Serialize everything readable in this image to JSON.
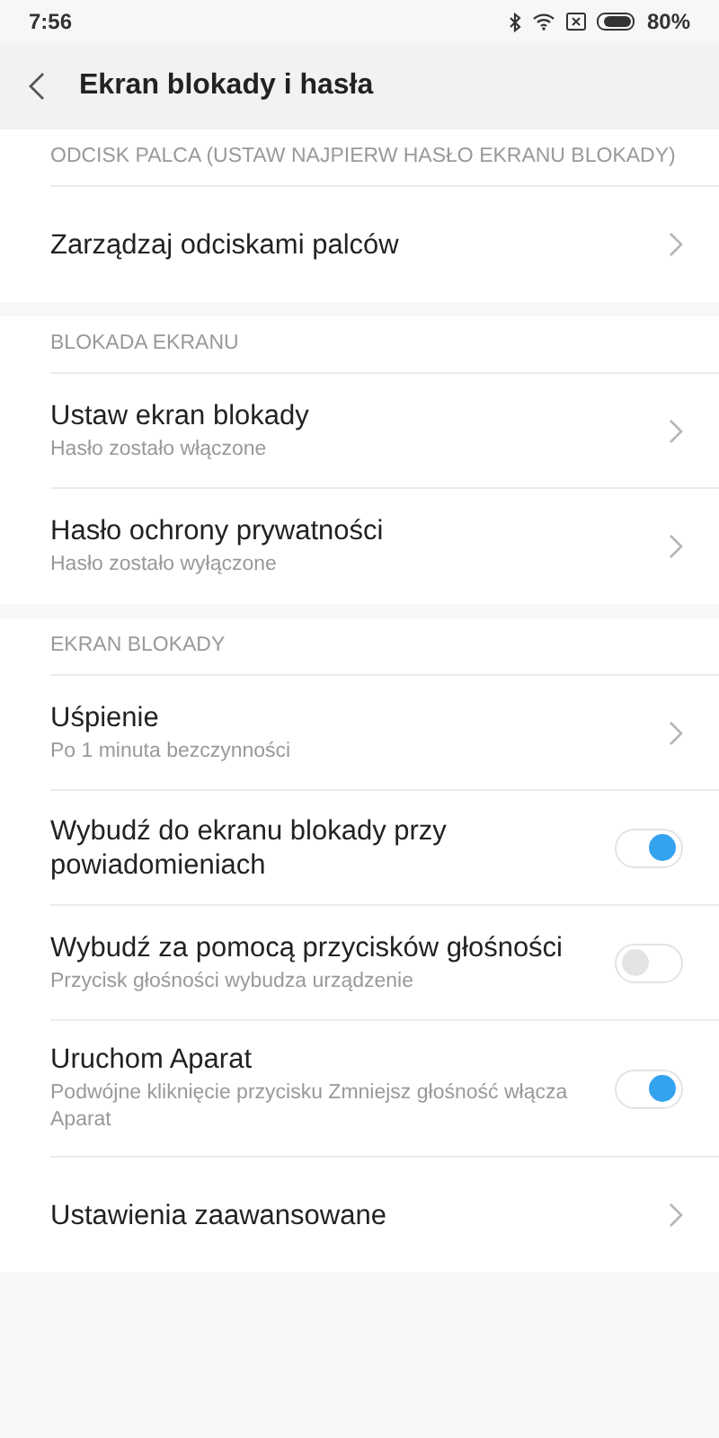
{
  "status_bar": {
    "time": "7:56",
    "battery": "80%"
  },
  "header": {
    "title": "Ekran blokady i hasła"
  },
  "sections": [
    {
      "title": "ODCISK PALCA (USTAW NAJPIERW HASŁO EKRANU BLOKADY)",
      "items": [
        {
          "kind": "link",
          "label": "Zarządzaj odciskami palców"
        }
      ]
    },
    {
      "title": "BLOKADA EKRANU",
      "items": [
        {
          "kind": "link",
          "label": "Ustaw ekran blokady",
          "subtitle": "Hasło zostało włączone"
        },
        {
          "kind": "link",
          "label": "Hasło ochrony prywatności",
          "subtitle": "Hasło zostało wyłączone"
        }
      ]
    },
    {
      "title": "EKRAN BLOKADY",
      "items": [
        {
          "kind": "link",
          "label": "Uśpienie",
          "subtitle": "Po 1 minuta bezczynności"
        },
        {
          "kind": "toggle",
          "label": "Wybudź do ekranu blokady przy powiadomieniach",
          "on": true
        },
        {
          "kind": "toggle",
          "label": "Wybudź za pomocą przycisków głośności",
          "subtitle": "Przycisk głośności wybudza urządzenie",
          "on": false
        },
        {
          "kind": "toggle",
          "label": "Uruchom Aparat",
          "subtitle": "Podwójne kliknięcie przycisku Zmniejsz głośność włącza Aparat",
          "on": true
        },
        {
          "kind": "link",
          "label": "Ustawienia zaawansowane"
        }
      ]
    }
  ]
}
